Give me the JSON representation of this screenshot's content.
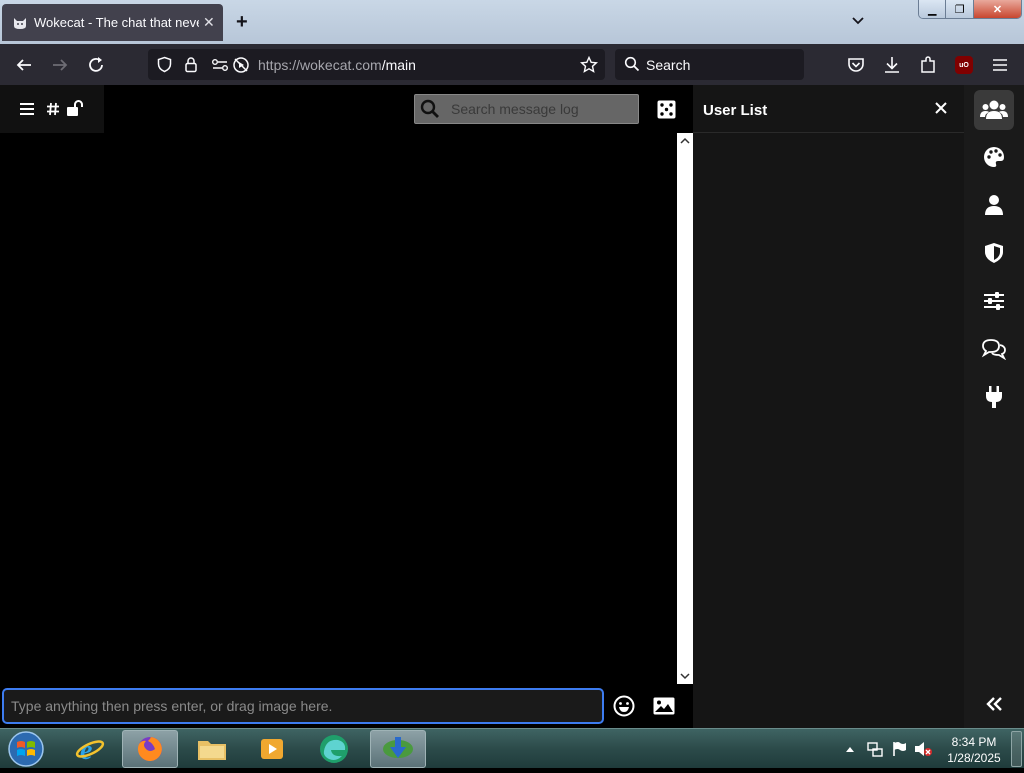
{
  "browser": {
    "tab_title": "Wokecat - The chat that never",
    "url_domain": "https://wokecat.com",
    "url_path": "/main",
    "search_placeholder": "Search",
    "ublock_badge": "uO"
  },
  "chat": {
    "search_log_placeholder": "Search message log",
    "input_placeholder": "Type anything then press enter, or drag image here."
  },
  "user_panel": {
    "title": "User List"
  },
  "taskbar": {
    "time": "8:34 PM",
    "date": "1/28/2025"
  },
  "colors": {
    "accent_focus": "#3d7cf0",
    "panel_bg": "#151515",
    "chat_bg": "#000000"
  }
}
